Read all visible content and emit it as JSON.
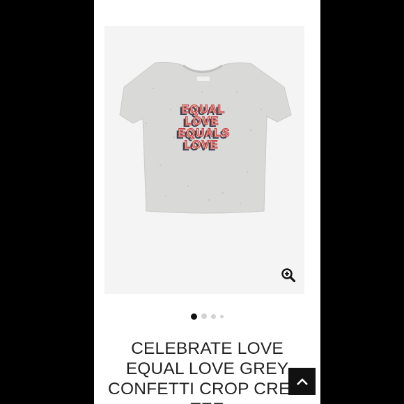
{
  "product": {
    "title": "CELEBRATE LOVE EQUAL LOVE GREY CONFETTI CROP CREW TEE",
    "shirt_color": "#d9dad8",
    "graphic": {
      "lines": [
        "EQUAL",
        "LOVE",
        "EQUALS",
        "LOVE"
      ],
      "fill_color": "#e9b79a",
      "outline_color": "#c8414a",
      "shadow_color": "#3d4150"
    }
  },
  "carousel": {
    "dot_count": 4,
    "active_index": 0
  },
  "icons": {
    "zoom": "zoom-in-icon",
    "scroll_top": "chevron-up-icon"
  }
}
